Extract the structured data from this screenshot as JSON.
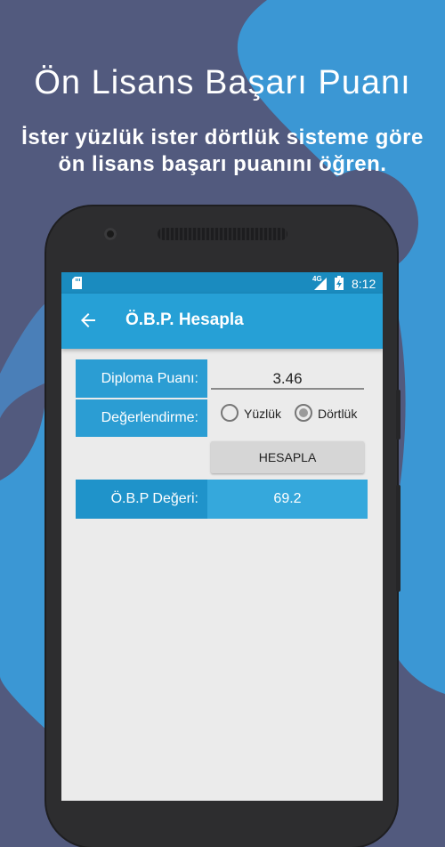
{
  "promo": {
    "title": "Ön Lisans Başarı Puanı",
    "subtitle_line1": "İster yüzlük ister dörtlük sisteme göre",
    "subtitle_line2": "ön lisans başarı puanını öğren."
  },
  "status_bar": {
    "network": "4G",
    "time": "8:12"
  },
  "app_bar": {
    "back_icon": "arrow-back-icon",
    "title": "Ö.B.P. Hesapla"
  },
  "form": {
    "diploma_label": "Diploma Puanı:",
    "diploma_value": "3.46",
    "evaluation_label": "Değerlendirme:",
    "options": [
      "Yüzlük",
      "Dörtlük"
    ],
    "selected_option": "Dörtlük",
    "calculate_button": "HESAPLA",
    "result_label": "Ö.B.P Değeri:",
    "result_value": "69.2"
  },
  "colors": {
    "background": "#525a7e",
    "accent_blue": "#2b9dd3",
    "status_bar": "#1a8bbf",
    "app_bar": "#26a0d6"
  }
}
